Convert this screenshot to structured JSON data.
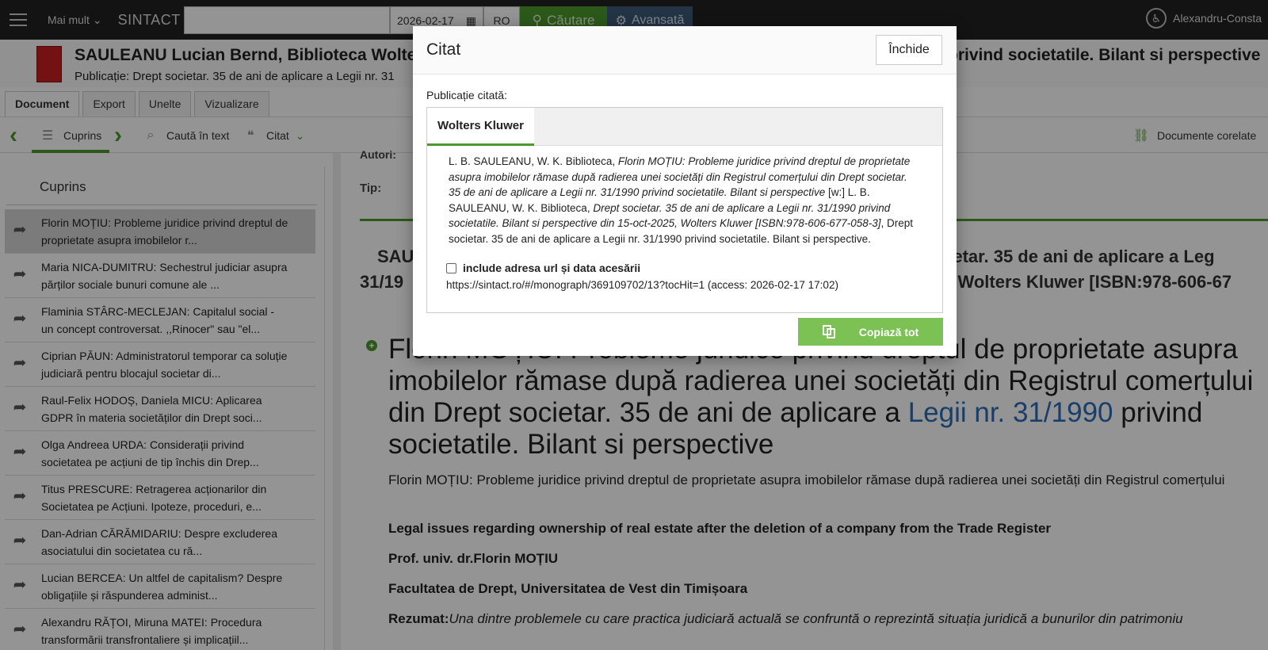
{
  "topbar": {
    "more_label": "Mai mult",
    "brand": "SINTACT",
    "search_value": "",
    "date_value": "2026-02-17",
    "lang_value": "RO",
    "search_button": "Căutare",
    "advanced_button": "Avansată",
    "user_name": "Alexandru-Consta"
  },
  "docheader": {
    "title_left": "SAULEANU Lucian Bernd, Biblioteca Wolte",
    "title_right": "privind societatile. Bilant si perspective",
    "publication": "Publicație: Drept societar. 35 de ani de aplicare a Legii nr. 31"
  },
  "tabs": [
    "Document",
    "Export",
    "Unelte",
    "Vizualizare"
  ],
  "toolbar": {
    "cuprins": "Cuprins",
    "search_in_text": "Caută în text",
    "citat": "Citat",
    "related_docs": "Documente corelate"
  },
  "sidebar": {
    "title": "Cuprins",
    "items": [
      "Florin MOȚIU: Probleme juridice privind dreptul de proprietate asupra imobilelor r...",
      "Maria NICA-DUMITRU: Sechestrul judiciar asupra părților sociale bunuri comune ale ...",
      "Flaminia STÂRC-MECLEJAN: Capitalul social - un concept controversat. ,,Rinocer\" sau \"el...",
      "Ciprian PĂUN: Administratorul temporar ca soluție judiciară pentru blocajul societar di...",
      "Raul-Felix HODOȘ, Daniela MICU: Aplicarea GDPR în materia societăților din Drept soci...",
      "Olga Andreea URDA: Considerații privind societatea pe acțiuni de tip închis din Drep...",
      "Titus PRESCURE: Retragerea acționarilor din Societatea pe Acțiuni. Ipoteze, proceduri, e...",
      "Dan-Adrian CĂRĂMIDARIU: Despre excluderea asociatului din societatea cu ră...",
      "Lucian BERCEA: Un altfel de capitalism? Despre obligațiile și răspunderea administ...",
      "Alexandru RĂȚOI, Miruna MATEI: Procedura transformării transfrontaliere și implicațiil..."
    ]
  },
  "main": {
    "autori": "Autori:",
    "tip": "Tip:",
    "head_l1": "SAU",
    "head_l2": "31/19",
    "head_r1": "cietar. 35 de ani de aplicare a Leg",
    "head_r2": "5, Wolters Kluwer [ISBN:978-606-67",
    "big_title_pre": "Florin MOȚIU: Probleme juridice privind dreptul de proprietate asupra imobilelor rămase după radierea unei societăți din Registrul comerțului din Drept societar. 35 de ani de aplicare a ",
    "big_title_link": "Legii nr. 31/1990",
    "big_title_post": " privind societatile. Bilant si perspective",
    "subtitle": "Florin MOȚIU: Probleme juridice privind dreptul de proprietate asupra imobilelor rămase după radierea unei societăți din Registrul comerțului",
    "bold1": "Legal issues regarding ownership of real estate after the deletion of a company from the Trade Register",
    "bold2": "Prof. univ. dr.Florin MOȚIU",
    "bold3": "Facultatea de Drept, Universitatea de Vest din Timișoara",
    "rezumat_label": "Rezumat:",
    "rezumat_text": "Una dintre problemele cu care practica judiciară actuală se confruntă o reprezintă situația juridică a bunurilor din patrimoniu"
  },
  "modal": {
    "title": "Citat",
    "close_button": "Închide",
    "pub_label": "Publicație citată:",
    "tab": "Wolters Kluwer",
    "cite_p1": "L. B. SAULEANU, W. K. Biblioteca, ",
    "cite_i1": "Florin MOȚIU: Probleme juridice privind dreptul de proprietate asupra imobilelor rămase după radierea unei societăți din Registrul comerțului din Drept societar. 35 de ani de aplicare a Legii nr. 31/1990 privind societatile. Bilant si perspective",
    "cite_p2": " [w:] L. B. SAULEANU, W. K. Biblioteca, ",
    "cite_i2": "Drept societar. 35 de ani de aplicare a Legii nr. 31/1990 privind societatile. Bilant si perspective din 15-oct-2025, Wolters Kluwer [ISBN:978-606-677-058-3]",
    "cite_p3": ", Drept societar. 35 de ani de aplicare a Legii nr. 31/1990 privind societatile. Bilant si perspective.",
    "checkbox_label": "include adresa url și data acesării",
    "url": "https://sintact.ro/#/monograph/369109702/13?tocHit=1 (access: 2026-02-17 17:02)",
    "copy_button": "Copiază tot"
  }
}
